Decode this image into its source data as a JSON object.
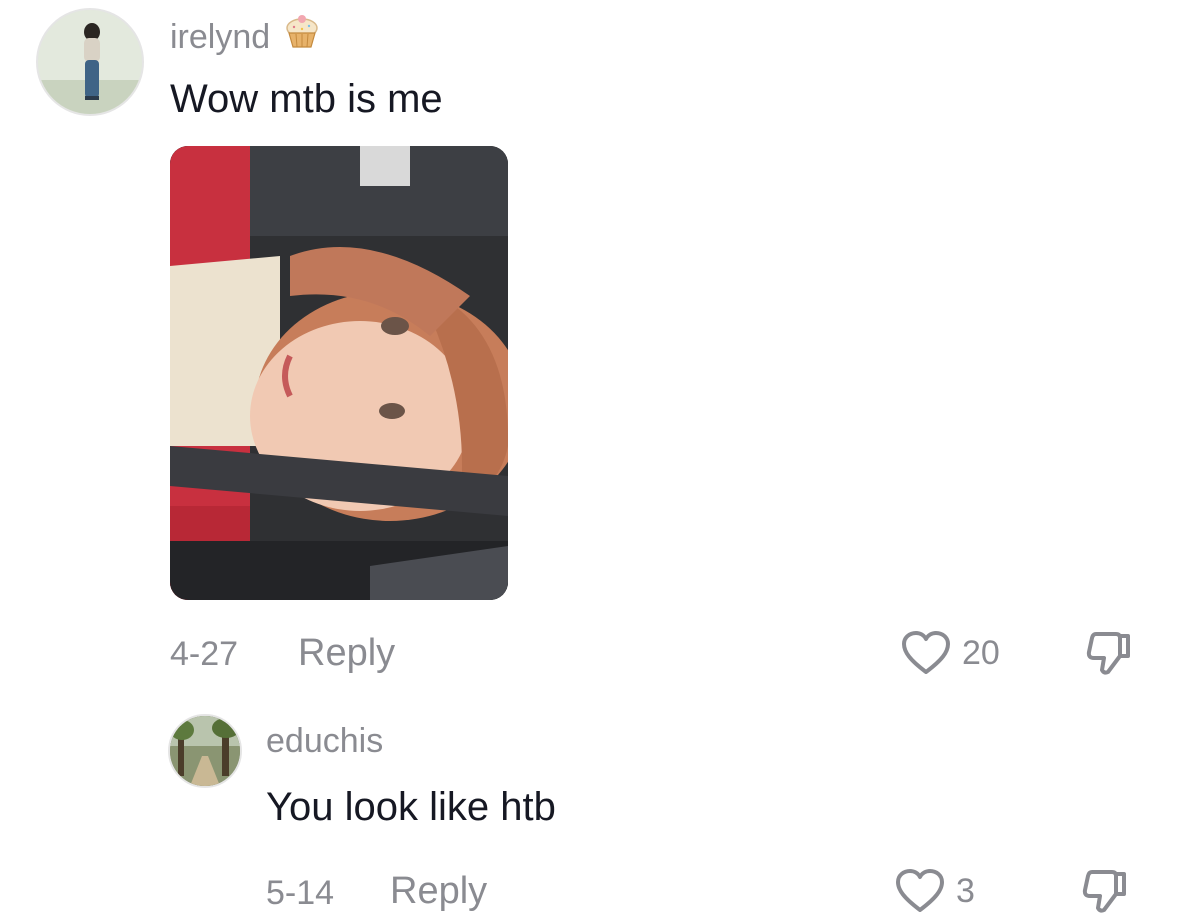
{
  "comments": [
    {
      "username": "irelynd",
      "badge_icon": "cupcake-icon",
      "text": "Wow mtb is me",
      "date": "4-27",
      "reply_label": "Reply",
      "like_count": "20",
      "has_photo": true
    },
    {
      "username": "educhis",
      "text": "You look like htb",
      "date": "5-14",
      "reply_label": "Reply",
      "like_count": "3"
    }
  ],
  "colors": {
    "muted_text": "#8a8b91",
    "primary_text": "#161823",
    "background": "#ffffff"
  }
}
